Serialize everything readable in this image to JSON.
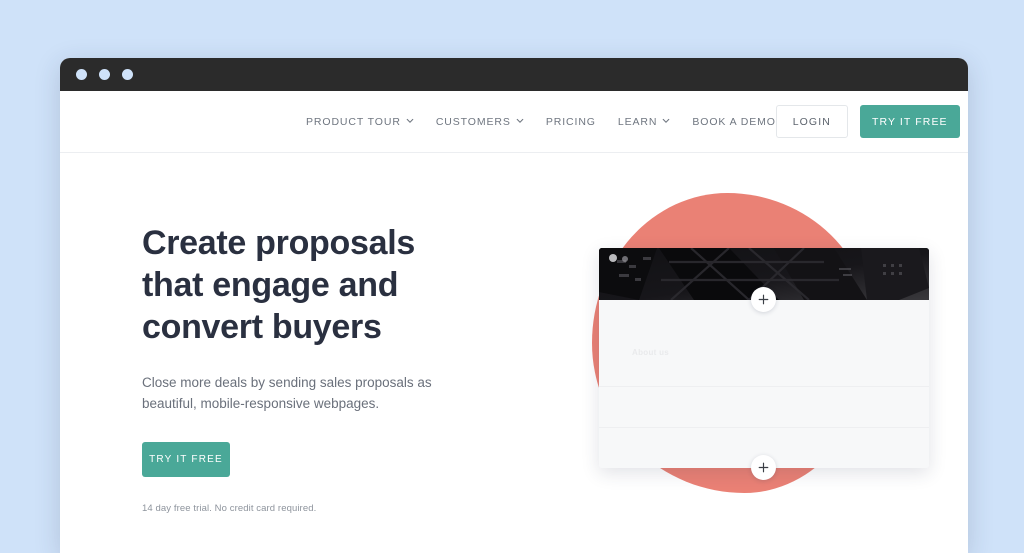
{
  "page": {
    "background_color": "#cfe2f9",
    "accent_teal": "#4aa898",
    "accent_salmon": "#ea8175",
    "headline_color": "#2a3040"
  },
  "browser": {
    "titlebar_color": "#2b2b2b",
    "dots": [
      "window-dot-1",
      "window-dot-2",
      "window-dot-3"
    ]
  },
  "navbar": {
    "links": [
      {
        "label": "PRODUCT TOUR",
        "has_dropdown": true
      },
      {
        "label": "CUSTOMERS",
        "has_dropdown": true
      },
      {
        "label": "PRICING",
        "has_dropdown": false
      },
      {
        "label": "LEARN",
        "has_dropdown": true
      },
      {
        "label": "BOOK A DEMO",
        "has_dropdown": false
      }
    ],
    "login_label": "LOGIN",
    "try_free_label": "TRY IT FREE"
  },
  "hero": {
    "headline_line1": "Create proposals",
    "headline_line2": "that engage and",
    "headline_line3": "convert buyers",
    "subtext": "Close more deals by sending sales proposals as beautiful, mobile-responsive webpages.",
    "cta_label": "TRY IT FREE",
    "disclaimer": "14 day free trial. No credit card required."
  },
  "proposal_card": {
    "section_heading": "About us",
    "plus_top_label": "+",
    "plus_bottom_label": "+"
  }
}
